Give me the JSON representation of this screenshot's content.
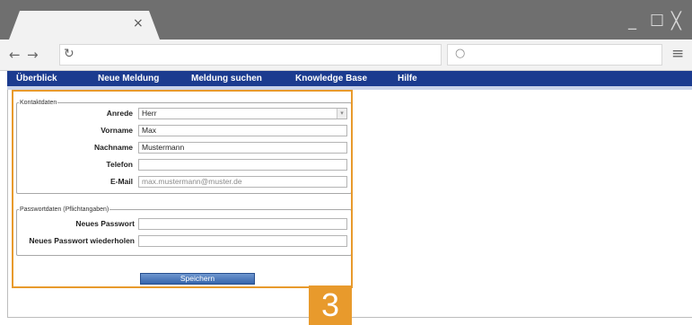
{
  "browser": {
    "tab_close_glyph": "×",
    "back_glyph": "←",
    "forward_glyph": "→",
    "reload_glyph": "↻",
    "search_glyph": "○",
    "menu_glyph": "≡",
    "minimize_glyph": "_",
    "maximize_glyph": "☐",
    "close_glyph": "╳"
  },
  "nav": {
    "items": [
      {
        "label": "Überblick"
      },
      {
        "label": "Neue Meldung"
      },
      {
        "label": "Meldung suchen"
      },
      {
        "label": "Knowledge Base"
      },
      {
        "label": "Hilfe"
      }
    ]
  },
  "contact": {
    "legend": "Kontaktdaten",
    "anrede_label": "Anrede",
    "anrede_value": "Herr",
    "vorname_label": "Vorname",
    "vorname_value": "Max",
    "nachname_label": "Nachname",
    "nachname_value": "Mustermann",
    "telefon_label": "Telefon",
    "telefon_value": "",
    "email_label": "E-Mail",
    "email_value": "max.mustermann@muster.de"
  },
  "password": {
    "legend": "Passwortdaten (Pflichtangaben)",
    "new_label": "Neues Passwort",
    "repeat_label": "Neues Passwort wiederholen"
  },
  "save_label": "Speichern",
  "callout": {
    "number": "3",
    "color": "#e89a2c"
  },
  "colors": {
    "nav_bar": "#1b3b8f",
    "chrome": "#6f6f6f"
  }
}
